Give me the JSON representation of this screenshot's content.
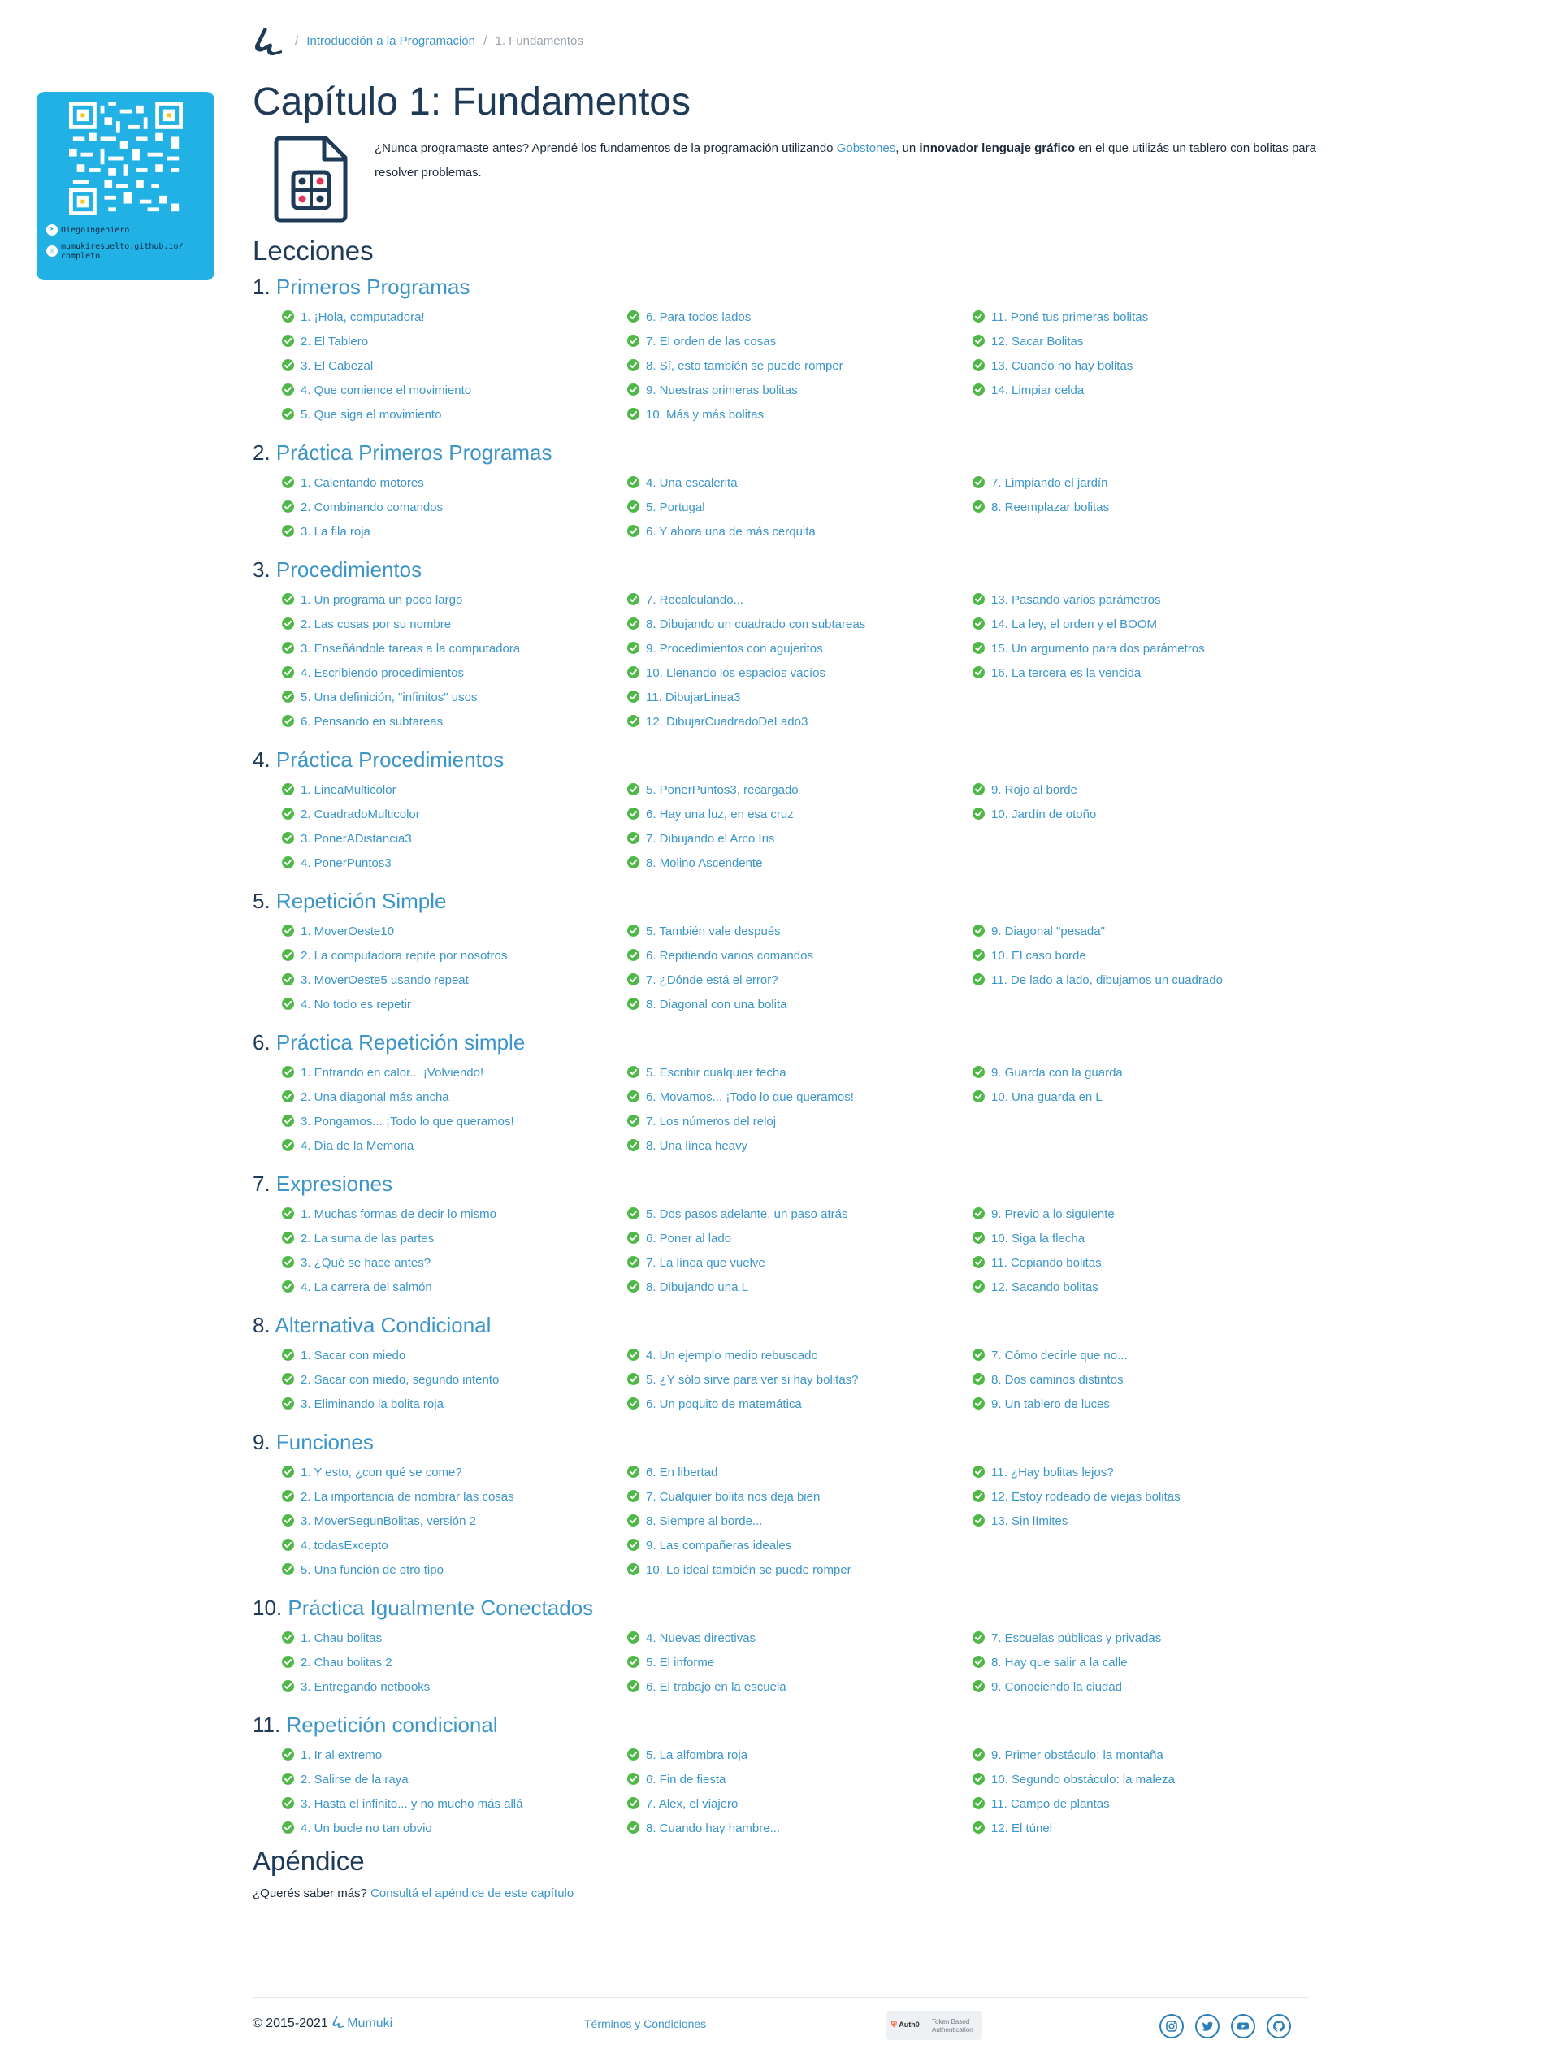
{
  "breadcrumb": {
    "course": "Introducción a la Programación",
    "current": "1. Fundamentos"
  },
  "qr_card": {
    "telegram": "DiegoIngeniero",
    "url": "mumukiresuelto.github.io/\ncompleto"
  },
  "chapter": {
    "title": "Capítulo 1: Fundamentos",
    "intro": {
      "p1": "¿Nunca programaste antes? Aprendé los fundamentos de la programación utilizando ",
      "link": "Gobstones",
      "p2": ", un ",
      "bold": "innovador lenguaje gráfico",
      "p3": " en el que utilizás un tablero con bolitas para resolver problemas."
    }
  },
  "lessons_title": "Lecciones",
  "lessons": [
    {
      "number": "1.",
      "name": "Primeros Programas",
      "columns": [
        [
          "1. ¡Hola, computadora!",
          "2. El Tablero",
          "3. El Cabezal",
          "4. Que comience el movimiento",
          "5. Que siga el movimiento"
        ],
        [
          "6. Para todos lados",
          "7. El orden de las cosas",
          "8. Sí, esto también se puede romper",
          "9. Nuestras primeras bolitas",
          "10. Más y más bolitas"
        ],
        [
          "11. Poné tus primeras bolitas",
          "12. Sacar Bolitas",
          "13. Cuando no hay bolitas",
          "14. Limpiar celda"
        ]
      ]
    },
    {
      "number": "2.",
      "name": "Práctica Primeros Programas",
      "columns": [
        [
          "1. Calentando motores",
          "2. Combinando comandos",
          "3. La fila roja"
        ],
        [
          "4. Una escalerita",
          "5. Portugal",
          "6. Y ahora una de más cerquita"
        ],
        [
          "7. Limpiando el jardín",
          "8. Reemplazar bolitas"
        ]
      ]
    },
    {
      "number": "3.",
      "name": "Procedimientos",
      "columns": [
        [
          "1. Un programa un poco largo",
          "2. Las cosas por su nombre",
          "3. Enseñándole tareas a la computadora",
          "4. Escribiendo procedimientos",
          "5. Una definición, \"infinitos\" usos",
          "6. Pensando en subtareas"
        ],
        [
          "7. Recalculando...",
          "8. Dibujando un cuadrado con subtareas",
          "9. Procedimientos con agujeritos",
          "10. Llenando los espacios vacíos",
          "11. DibujarLinea3",
          "12. DibujarCuadradoDeLado3"
        ],
        [
          "13. Pasando varios parámetros",
          "14. La ley, el orden y el BOOM",
          "15. Un argumento para dos parámetros",
          "16. La tercera es la vencida"
        ]
      ]
    },
    {
      "number": "4.",
      "name": "Práctica Procedimientos",
      "columns": [
        [
          "1. LineaMulticolor",
          "2. CuadradoMulticolor",
          "3. PonerADistancia3",
          "4. PonerPuntos3"
        ],
        [
          "5. PonerPuntos3, recargado",
          "6. Hay una luz, en esa cruz",
          "7. Dibujando el Arco Iris",
          "8. Molino Ascendente"
        ],
        [
          "9. Rojo al borde",
          "10. Jardín de otoño"
        ]
      ]
    },
    {
      "number": "5.",
      "name": "Repetición Simple",
      "columns": [
        [
          "1. MoverOeste10",
          "2. La computadora repite por nosotros",
          "3. MoverOeste5 usando repeat",
          "4. No todo es repetir"
        ],
        [
          "5. También vale después",
          "6. Repitiendo varios comandos",
          "7. ¿Dónde está el error?",
          "8. Diagonal con una bolita"
        ],
        [
          "9. Diagonal \"pesada\"",
          "10. El caso borde",
          "11. De lado a lado, dibujamos un cuadrado"
        ]
      ]
    },
    {
      "number": "6.",
      "name": "Práctica Repetición simple",
      "columns": [
        [
          "1. Entrando en calor... ¡Volviendo!",
          "2. Una diagonal más ancha",
          "3. Pongamos... ¡Todo lo que queramos!",
          "4. Día de la Memoria"
        ],
        [
          "5. Escribir cualquier fecha",
          "6. Movamos... ¡Todo lo que queramos!",
          "7. Los números del reloj",
          "8. Una línea heavy"
        ],
        [
          "9. Guarda con la guarda",
          "10. Una guarda en L"
        ]
      ]
    },
    {
      "number": "7.",
      "name": "Expresiones",
      "columns": [
        [
          "1. Muchas formas de decir lo mismo",
          "2. La suma de las partes",
          "3. ¿Qué se hace antes?",
          "4. La carrera del salmón"
        ],
        [
          "5. Dos pasos adelante, un paso atrás",
          "6. Poner al lado",
          "7. La línea que vuelve",
          "8. Dibujando una L"
        ],
        [
          "9. Previo a lo siguiente",
          "10. Siga la flecha",
          "11. Copiando bolitas",
          "12. Sacando bolitas"
        ]
      ]
    },
    {
      "number": "8.",
      "name": "Alternativa Condicional",
      "columns": [
        [
          "1. Sacar con miedo",
          "2. Sacar con miedo, segundo intento",
          "3. Eliminando la bolita roja"
        ],
        [
          "4. Un ejemplo medio rebuscado",
          "5. ¿Y sólo sirve para ver si hay bolitas?",
          "6. Un poquito de matemática"
        ],
        [
          "7. Cómo decirle que no...",
          "8. Dos caminos distintos",
          "9. Un tablero de luces"
        ]
      ]
    },
    {
      "number": "9.",
      "name": "Funciones",
      "columns": [
        [
          "1. Y esto, ¿con qué se come?",
          "2. La importancia de nombrar las cosas",
          "3. MoverSegunBolitas, versión 2",
          "4. todasExcepto",
          "5. Una función de otro tipo"
        ],
        [
          "6. En libertad",
          "7. Cualquier bolita nos deja bien",
          "8. Siempre al borde...",
          "9. Las compañeras ideales",
          "10. Lo ideal también se puede romper"
        ],
        [
          "11. ¿Hay bolitas lejos?",
          "12. Estoy rodeado de viejas bolitas",
          "13. Sin límites"
        ]
      ]
    },
    {
      "number": "10.",
      "name": "Práctica Igualmente Conectados",
      "columns": [
        [
          "1. Chau bolitas",
          "2. Chau bolitas 2",
          "3. Entregando netbooks"
        ],
        [
          "4. Nuevas directivas",
          "5. El informe",
          "6. El trabajo en la escuela"
        ],
        [
          "7. Escuelas públicas y privadas",
          "8. Hay que salir a la calle",
          "9. Conociendo la ciudad"
        ]
      ]
    },
    {
      "number": "11.",
      "name": "Repetición condicional",
      "columns": [
        [
          "1. Ir al extremo",
          "2. Salirse de la raya",
          "3. Hasta el infinito... y no mucho más allá",
          "4. Un bucle no tan obvio"
        ],
        [
          "5. La alfombra roja",
          "6. Fin de fiesta",
          "7. Alex, el viajero",
          "8. Cuando hay hambre..."
        ],
        [
          "9. Primer obstáculo: la montaña",
          "10. Segundo obstáculo: la maleza",
          "11. Campo de plantas",
          "12. El túnel"
        ]
      ]
    }
  ],
  "appendix": {
    "title": "Apéndice",
    "question": "¿Querés saber más? ",
    "link": "Consultá el apéndice de este capítulo"
  },
  "footer": {
    "copyright": "© 2015-2021 ",
    "brand": "Mumuki",
    "terms": "Términos y Condiciones",
    "auth0_name": "Auth0",
    "auth0_text": "Token Based Authentication",
    "social": [
      "instagram-icon",
      "twitter-icon",
      "youtube-icon",
      "github-icon"
    ]
  },
  "colors": {
    "link": "#3c95c8",
    "check": "#50b848",
    "qr_card": "#22b1e4",
    "heading": "#1f3a57"
  }
}
